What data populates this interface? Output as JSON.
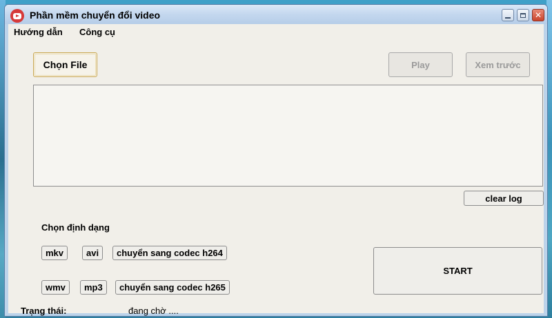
{
  "window": {
    "title": "Phần mềm chuyển đổi video",
    "icon": "video-play-icon",
    "controls": {
      "minimize": "minimize-icon",
      "maximize": "maximize-icon",
      "close": "close-icon"
    }
  },
  "menu": {
    "items": [
      {
        "label": "Hướng dẫn"
      },
      {
        "label": "Công cụ"
      }
    ]
  },
  "toolbar": {
    "choose_file_label": "Chọn File",
    "play_label": "Play",
    "preview_label": "Xem trước"
  },
  "log": {
    "content": "",
    "clear_label": "clear log"
  },
  "formats": {
    "heading": "Chọn định dạng",
    "row1": [
      "mkv",
      "avi",
      "chuyển sang codec h264"
    ],
    "row2": [
      "wmv",
      "mp3",
      "chuyển sang codec h265"
    ]
  },
  "start_label": "START",
  "status": {
    "label": "Trạng thái:",
    "value": "đang chờ ...."
  },
  "colors": {
    "titlebar": "#c3d7ee",
    "client_bg": "#f1efe9",
    "close_button": "#c9442c",
    "focus_border": "#c8a54c"
  }
}
